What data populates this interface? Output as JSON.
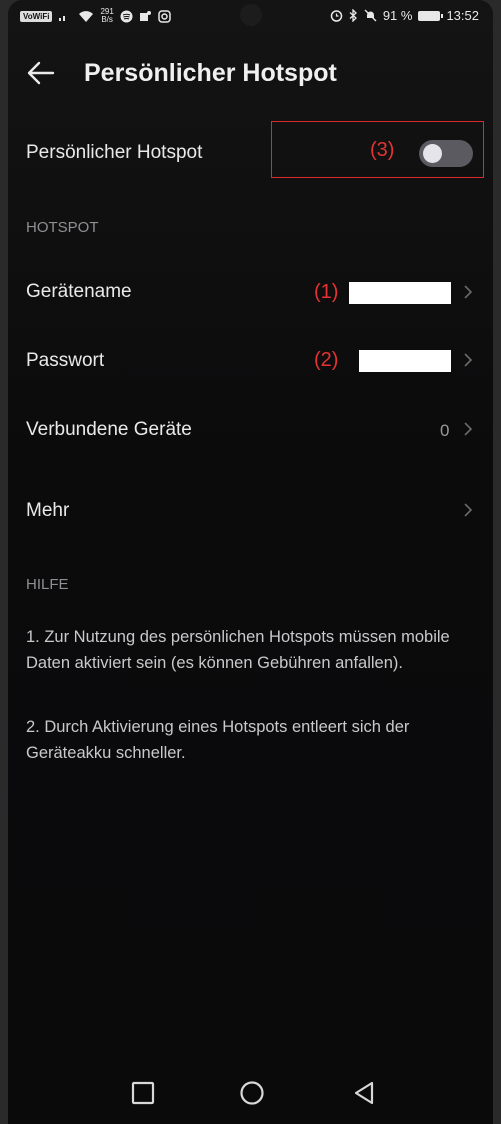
{
  "status_bar": {
    "vowifi": "VoWiFi",
    "net_speed_value": "291",
    "net_speed_unit": "B/s",
    "battery": "91 %",
    "time": "13:52"
  },
  "header": {
    "title": "Persönlicher Hotspot"
  },
  "hotspot_toggle": {
    "label": "Persönlicher Hotspot",
    "enabled": false,
    "annotation": "(3)"
  },
  "sections": {
    "hotspot": "HOTSPOT",
    "help": "HILFE"
  },
  "rows": {
    "device_name": {
      "label": "Gerätename",
      "annotation": "(1)"
    },
    "password": {
      "label": "Passwort",
      "annotation": "(2)"
    },
    "connected_devices": {
      "label": "Verbundene Geräte",
      "value": "0"
    },
    "more": {
      "label": "Mehr"
    }
  },
  "help_text": [
    "1. Zur Nutzung des persönlichen Hotspots müssen mobile Daten aktiviert sein (es können Gebühren anfallen).",
    "2. Durch Aktivierung eines Hotspots entleert sich der Geräteakku schneller."
  ],
  "colors": {
    "annotation": "#e53333",
    "background": "#0b0b0c",
    "section_header": "#8f8f94"
  }
}
